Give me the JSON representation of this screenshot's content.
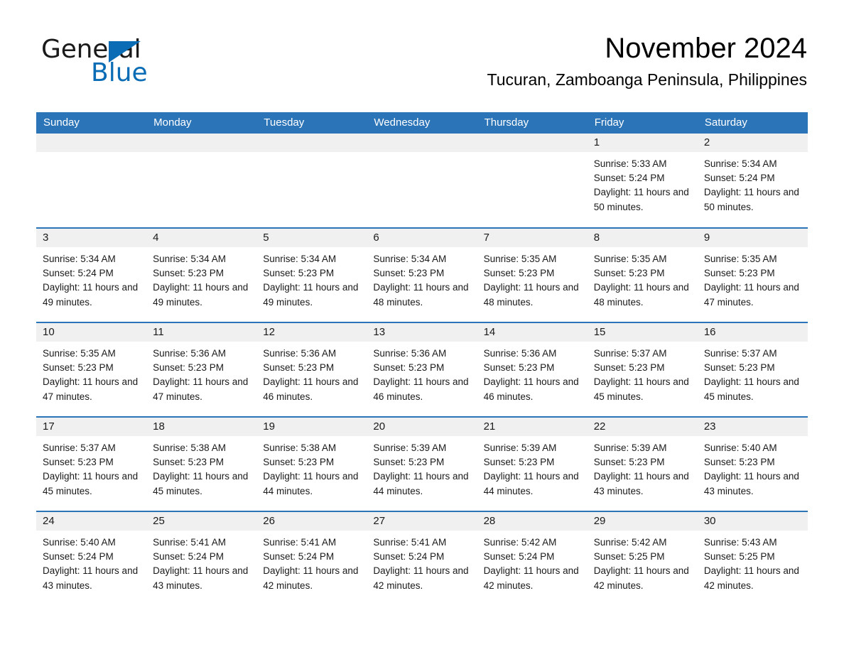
{
  "brand": {
    "name_part1": "General",
    "name_part2": "Blue",
    "accent_color": "#0a6cb5",
    "triangle_icon": "triangle-icon"
  },
  "header": {
    "month_title": "November 2024",
    "location": "Tucuran, Zamboanga Peninsula, Philippines"
  },
  "calendar": {
    "header_bg": "#2b74b8",
    "daynum_bg": "#f0f0f0",
    "weekday_headers": [
      "Sunday",
      "Monday",
      "Tuesday",
      "Wednesday",
      "Thursday",
      "Friday",
      "Saturday"
    ],
    "weeks": [
      [
        {
          "day": "",
          "lines": []
        },
        {
          "day": "",
          "lines": []
        },
        {
          "day": "",
          "lines": []
        },
        {
          "day": "",
          "lines": []
        },
        {
          "day": "",
          "lines": []
        },
        {
          "day": "1",
          "lines": [
            "Sunrise: 5:33 AM",
            "Sunset: 5:24 PM",
            "Daylight: 11 hours and 50 minutes."
          ]
        },
        {
          "day": "2",
          "lines": [
            "Sunrise: 5:34 AM",
            "Sunset: 5:24 PM",
            "Daylight: 11 hours and 50 minutes."
          ]
        }
      ],
      [
        {
          "day": "3",
          "lines": [
            "Sunrise: 5:34 AM",
            "Sunset: 5:24 PM",
            "Daylight: 11 hours and 49 minutes."
          ]
        },
        {
          "day": "4",
          "lines": [
            "Sunrise: 5:34 AM",
            "Sunset: 5:23 PM",
            "Daylight: 11 hours and 49 minutes."
          ]
        },
        {
          "day": "5",
          "lines": [
            "Sunrise: 5:34 AM",
            "Sunset: 5:23 PM",
            "Daylight: 11 hours and 49 minutes."
          ]
        },
        {
          "day": "6",
          "lines": [
            "Sunrise: 5:34 AM",
            "Sunset: 5:23 PM",
            "Daylight: 11 hours and 48 minutes."
          ]
        },
        {
          "day": "7",
          "lines": [
            "Sunrise: 5:35 AM",
            "Sunset: 5:23 PM",
            "Daylight: 11 hours and 48 minutes."
          ]
        },
        {
          "day": "8",
          "lines": [
            "Sunrise: 5:35 AM",
            "Sunset: 5:23 PM",
            "Daylight: 11 hours and 48 minutes."
          ]
        },
        {
          "day": "9",
          "lines": [
            "Sunrise: 5:35 AM",
            "Sunset: 5:23 PM",
            "Daylight: 11 hours and 47 minutes."
          ]
        }
      ],
      [
        {
          "day": "10",
          "lines": [
            "Sunrise: 5:35 AM",
            "Sunset: 5:23 PM",
            "Daylight: 11 hours and 47 minutes."
          ]
        },
        {
          "day": "11",
          "lines": [
            "Sunrise: 5:36 AM",
            "Sunset: 5:23 PM",
            "Daylight: 11 hours and 47 minutes."
          ]
        },
        {
          "day": "12",
          "lines": [
            "Sunrise: 5:36 AM",
            "Sunset: 5:23 PM",
            "Daylight: 11 hours and 46 minutes."
          ]
        },
        {
          "day": "13",
          "lines": [
            "Sunrise: 5:36 AM",
            "Sunset: 5:23 PM",
            "Daylight: 11 hours and 46 minutes."
          ]
        },
        {
          "day": "14",
          "lines": [
            "Sunrise: 5:36 AM",
            "Sunset: 5:23 PM",
            "Daylight: 11 hours and 46 minutes."
          ]
        },
        {
          "day": "15",
          "lines": [
            "Sunrise: 5:37 AM",
            "Sunset: 5:23 PM",
            "Daylight: 11 hours and 45 minutes."
          ]
        },
        {
          "day": "16",
          "lines": [
            "Sunrise: 5:37 AM",
            "Sunset: 5:23 PM",
            "Daylight: 11 hours and 45 minutes."
          ]
        }
      ],
      [
        {
          "day": "17",
          "lines": [
            "Sunrise: 5:37 AM",
            "Sunset: 5:23 PM",
            "Daylight: 11 hours and 45 minutes."
          ]
        },
        {
          "day": "18",
          "lines": [
            "Sunrise: 5:38 AM",
            "Sunset: 5:23 PM",
            "Daylight: 11 hours and 45 minutes."
          ]
        },
        {
          "day": "19",
          "lines": [
            "Sunrise: 5:38 AM",
            "Sunset: 5:23 PM",
            "Daylight: 11 hours and 44 minutes."
          ]
        },
        {
          "day": "20",
          "lines": [
            "Sunrise: 5:39 AM",
            "Sunset: 5:23 PM",
            "Daylight: 11 hours and 44 minutes."
          ]
        },
        {
          "day": "21",
          "lines": [
            "Sunrise: 5:39 AM",
            "Sunset: 5:23 PM",
            "Daylight: 11 hours and 44 minutes."
          ]
        },
        {
          "day": "22",
          "lines": [
            "Sunrise: 5:39 AM",
            "Sunset: 5:23 PM",
            "Daylight: 11 hours and 43 minutes."
          ]
        },
        {
          "day": "23",
          "lines": [
            "Sunrise: 5:40 AM",
            "Sunset: 5:23 PM",
            "Daylight: 11 hours and 43 minutes."
          ]
        }
      ],
      [
        {
          "day": "24",
          "lines": [
            "Sunrise: 5:40 AM",
            "Sunset: 5:24 PM",
            "Daylight: 11 hours and 43 minutes."
          ]
        },
        {
          "day": "25",
          "lines": [
            "Sunrise: 5:41 AM",
            "Sunset: 5:24 PM",
            "Daylight: 11 hours and 43 minutes."
          ]
        },
        {
          "day": "26",
          "lines": [
            "Sunrise: 5:41 AM",
            "Sunset: 5:24 PM",
            "Daylight: 11 hours and 42 minutes."
          ]
        },
        {
          "day": "27",
          "lines": [
            "Sunrise: 5:41 AM",
            "Sunset: 5:24 PM",
            "Daylight: 11 hours and 42 minutes."
          ]
        },
        {
          "day": "28",
          "lines": [
            "Sunrise: 5:42 AM",
            "Sunset: 5:24 PM",
            "Daylight: 11 hours and 42 minutes."
          ]
        },
        {
          "day": "29",
          "lines": [
            "Sunrise: 5:42 AM",
            "Sunset: 5:25 PM",
            "Daylight: 11 hours and 42 minutes."
          ]
        },
        {
          "day": "30",
          "lines": [
            "Sunrise: 5:43 AM",
            "Sunset: 5:25 PM",
            "Daylight: 11 hours and 42 minutes."
          ]
        }
      ]
    ]
  }
}
